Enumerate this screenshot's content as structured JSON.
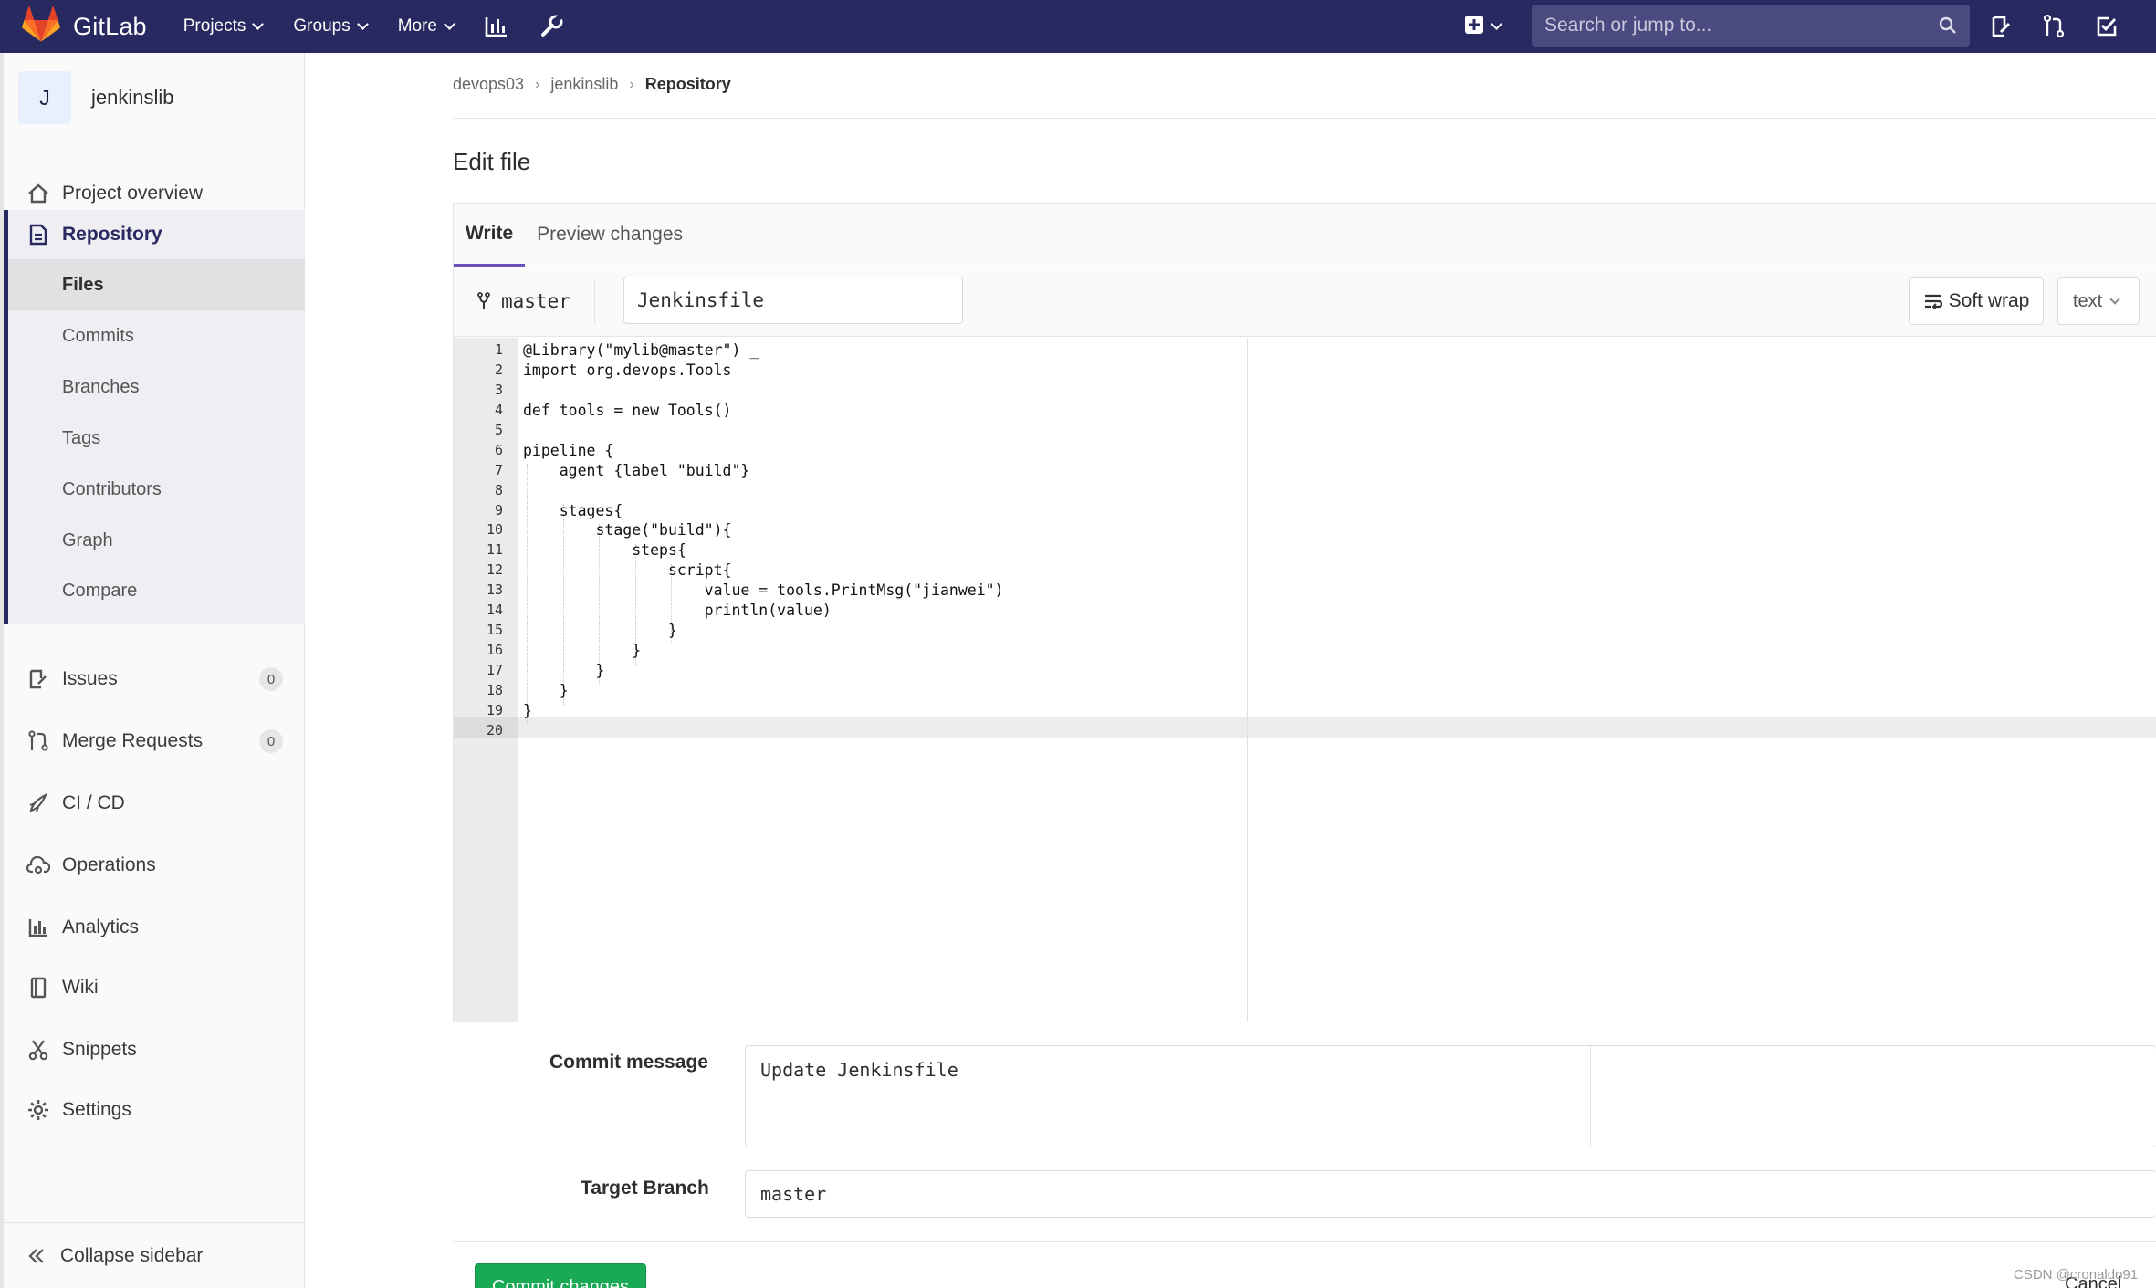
{
  "navbar": {
    "brand": "GitLab",
    "links": [
      {
        "label": "Projects"
      },
      {
        "label": "Groups"
      },
      {
        "label": "More"
      }
    ],
    "search_placeholder": "Search or jump to..."
  },
  "sidebar": {
    "project_avatar": "J",
    "project_name": "jenkinslib",
    "items": {
      "overview": "Project overview",
      "repository": "Repository",
      "issues": "Issues",
      "issues_count": "0",
      "merge_requests": "Merge Requests",
      "merge_requests_count": "0",
      "cicd": "CI / CD",
      "operations": "Operations",
      "analytics": "Analytics",
      "wiki": "Wiki",
      "snippets": "Snippets",
      "settings": "Settings"
    },
    "repo_sub": [
      "Files",
      "Commits",
      "Branches",
      "Tags",
      "Contributors",
      "Graph",
      "Compare"
    ],
    "collapse": "Collapse sidebar"
  },
  "breadcrumb": {
    "group": "devops03",
    "project": "jenkinslib",
    "current": "Repository"
  },
  "page_title": "Edit file",
  "editor": {
    "tabs": {
      "write": "Write",
      "preview": "Preview changes"
    },
    "branch": "master",
    "filename": "Jenkinsfile",
    "soft_wrap": "Soft wrap",
    "mode": "text",
    "lines": [
      "@Library(\"mylib@master\") _",
      "import org.devops.Tools",
      "",
      "def tools = new Tools()",
      "",
      "pipeline {",
      "    agent {label \"build\"}",
      "",
      "    stages{",
      "        stage(\"build\"){",
      "            steps{",
      "                script{",
      "                    value = tools.PrintMsg(\"jianwei\")",
      "                    println(value)",
      "                }",
      "            }",
      "        }",
      "    }",
      "}",
      ""
    ]
  },
  "form": {
    "commit_label": "Commit message",
    "commit_value": "Update Jenkinsfile",
    "target_label": "Target Branch",
    "target_value": "master",
    "commit_button": "Commit changes",
    "cancel_button": "Cancel"
  },
  "watermark": "CSDN @cronaldo91",
  "colors": {
    "navbar": "#292961",
    "accent": "#6b4fbb",
    "commit_button": "#1aaa55"
  }
}
